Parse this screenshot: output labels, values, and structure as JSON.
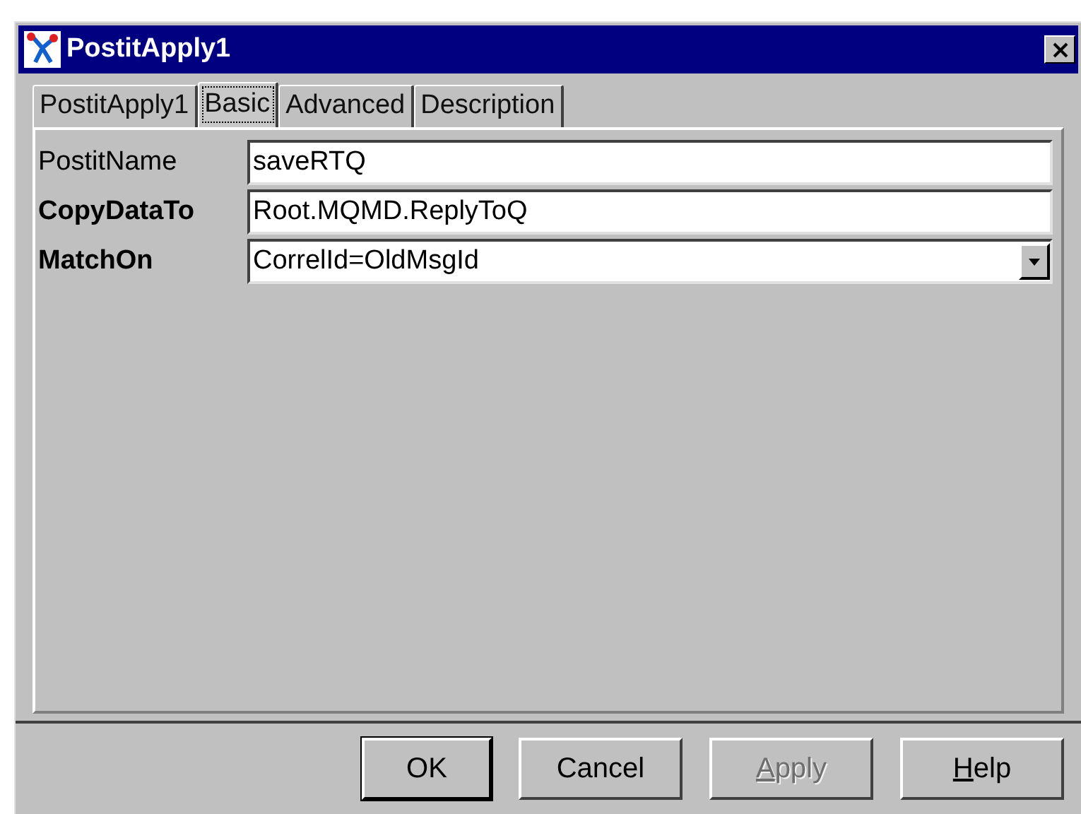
{
  "window": {
    "title": "PostitApply1"
  },
  "tabs": [
    {
      "label": "PostitApply1",
      "selected": false
    },
    {
      "label": "Basic",
      "selected": true
    },
    {
      "label": "Advanced",
      "selected": false
    },
    {
      "label": "Description",
      "selected": false
    }
  ],
  "fields": [
    {
      "label": "PostitName",
      "bold": false,
      "kind": "text",
      "value": "saveRTQ"
    },
    {
      "label": "CopyDataTo",
      "bold": true,
      "kind": "text",
      "value": "Root.MQMD.ReplyToQ"
    },
    {
      "label": "MatchOn",
      "bold": true,
      "kind": "dropdown",
      "value": "CorrelId=OldMsgId"
    }
  ],
  "buttons": [
    {
      "label": "OK",
      "default": true,
      "disabled": false,
      "mnemonic": false
    },
    {
      "label": "Cancel",
      "default": false,
      "disabled": false,
      "mnemonic": false
    },
    {
      "label": "Apply",
      "default": false,
      "disabled": true,
      "mnemonic": true
    },
    {
      "label": "Help",
      "default": false,
      "disabled": false,
      "mnemonic": true
    }
  ]
}
